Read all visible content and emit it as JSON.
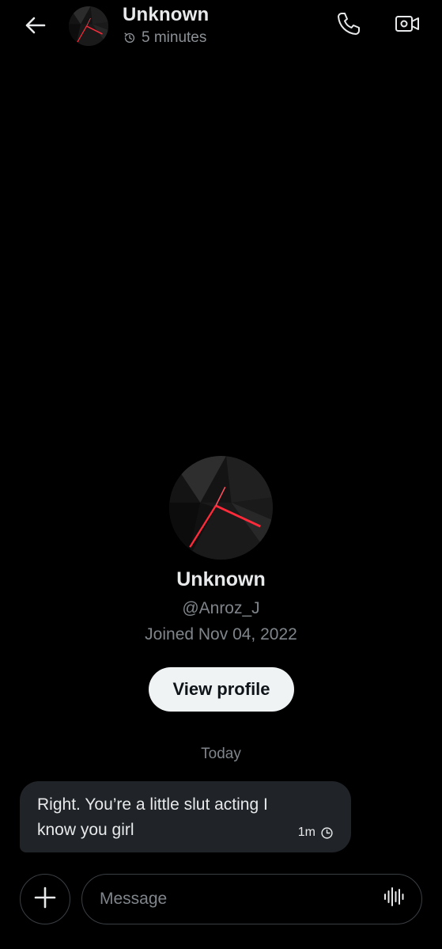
{
  "header": {
    "name": "Unknown",
    "status": "5 minutes",
    "back_icon": "arrow-left-icon",
    "call_icon": "phone-icon",
    "video_icon": "video-camera-icon"
  },
  "profile": {
    "name": "Unknown",
    "handle": "@Anroz_J",
    "joined": "Joined Nov 04, 2022",
    "view_profile_label": "View profile"
  },
  "conversation": {
    "date_separator": "Today",
    "messages": [
      {
        "text": "Right. You’re a little slut acting I know you girl",
        "time": "1m",
        "status_icon": "disappearing-clock-icon"
      }
    ]
  },
  "composer": {
    "placeholder": "Message",
    "add_icon": "plus-icon",
    "voice_icon": "audio-waveform-icon"
  },
  "colors": {
    "background": "#000000",
    "primary_text": "#e7e9ea",
    "secondary_text": "#7f858a",
    "bubble": "#202327",
    "button_bg": "#eff3f4",
    "avatar_accent": "#ff2a3a"
  }
}
